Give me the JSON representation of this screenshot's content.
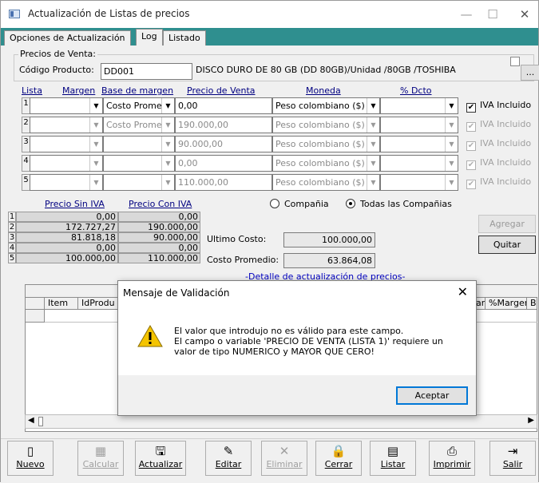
{
  "window": {
    "title": "Actualización de Listas de precios",
    "controls": {
      "minimize": "—",
      "maximize": "☐",
      "close": "✕"
    }
  },
  "tabs": [
    {
      "label": "Opciones de Actualización"
    },
    {
      "label": "Log"
    },
    {
      "label": "Listado"
    }
  ],
  "precios": {
    "group_label": "Precios de Venta:",
    "codigo_label": "Código Producto:",
    "codigo_value": "DD001",
    "descripcion": "DISCO DURO DE 80 GB (DD 80GB)/Unidad /80GB /TOSHIBA",
    "lookup_button": "...",
    "headers": {
      "lista": "Lista",
      "margen": "Margen",
      "base": "Base de margen",
      "precio": "Precio de Venta",
      "moneda": "Moneda",
      "dcto": "% Dcto"
    },
    "rows": [
      {
        "num": "1",
        "lista": "",
        "margen": "",
        "base": "Costo Prome",
        "precio": "0,00",
        "moneda": "Peso colombiano ($)",
        "dcto": "",
        "iva": "IVA Incluido",
        "enabled": true
      },
      {
        "num": "2",
        "lista": "",
        "margen": "",
        "base": "Costo Prome",
        "precio": "190.000,00",
        "moneda": "Peso colombiano ($)",
        "dcto": "",
        "iva": "IVA Incluido",
        "enabled": false
      },
      {
        "num": "3",
        "lista": "",
        "margen": "",
        "base": "",
        "precio": "90.000,00",
        "moneda": "Peso colombiano ($)",
        "dcto": "",
        "iva": "IVA Incluido",
        "enabled": false
      },
      {
        "num": "4",
        "lista": "",
        "margen": "",
        "base": "",
        "precio": "0,00",
        "moneda": "Peso colombiano ($)",
        "dcto": "",
        "iva": "IVA Incluido",
        "enabled": false
      },
      {
        "num": "5",
        "lista": "",
        "margen": "",
        "base": "",
        "precio": "110.000,00",
        "moneda": "Peso colombiano ($)",
        "dcto": "",
        "iva": "IVA Incluido",
        "enabled": false
      }
    ]
  },
  "summary": {
    "sin_iva_label": "Precio Sin IVA",
    "con_iva_label": "Precio Con IVA",
    "rows": [
      {
        "num": "1",
        "sin": "0,00",
        "con": "0,00"
      },
      {
        "num": "2",
        "sin": "172.727,27",
        "con": "190.000,00"
      },
      {
        "num": "3",
        "sin": "81.818,18",
        "con": "90.000,00"
      },
      {
        "num": "4",
        "sin": "0,00",
        "con": "0,00"
      },
      {
        "num": "5",
        "sin": "100.000,00",
        "con": "110.000,00"
      }
    ],
    "radio_compania": "Compañia",
    "radio_todas": "Todas las Compañias",
    "ultimo_costo_label": "Ultimo Costo:",
    "ultimo_costo_value": "100.000,00",
    "costo_promedio_label": "Costo Promedio:",
    "costo_promedio_value": "63.864,08",
    "detalle_label": "-Detalle de actualización de precios-",
    "agregar": "Agregar",
    "quitar": "Quitar"
  },
  "grid": {
    "columns_left": [
      "Item",
      "IdProdu"
    ],
    "columns_right": [
      "ar",
      "%Margen",
      "Ba"
    ]
  },
  "dialog": {
    "title": "Mensaje de Validación",
    "close": "✕",
    "message": "El valor que introdujo no es válido para este campo.\nEl campo o variable 'PRECIO DE VENTA (LISTA 1)' requiere un\nvalor de tipo NUMERICO y MAYOR QUE CERO!",
    "button": "Aceptar",
    "icon": "warning-icon"
  },
  "toolbar": [
    {
      "label": "Nuevo",
      "icon": "new-file-icon",
      "enabled": true
    },
    {
      "label": "Calcular",
      "icon": "calculator-icon",
      "enabled": false
    },
    {
      "label": "Actualizar",
      "icon": "save-icon",
      "enabled": true
    },
    {
      "label": "Editar",
      "icon": "edit-icon",
      "enabled": true
    },
    {
      "label": "Eliminar",
      "icon": "delete-icon",
      "enabled": false
    },
    {
      "label": "Cerrar",
      "icon": "lock-icon",
      "enabled": true
    },
    {
      "label": "Listar",
      "icon": "list-icon",
      "enabled": true
    },
    {
      "label": "Imprimir",
      "icon": "printer-icon",
      "enabled": true
    },
    {
      "label": "Salir",
      "icon": "exit-icon",
      "enabled": true
    }
  ]
}
